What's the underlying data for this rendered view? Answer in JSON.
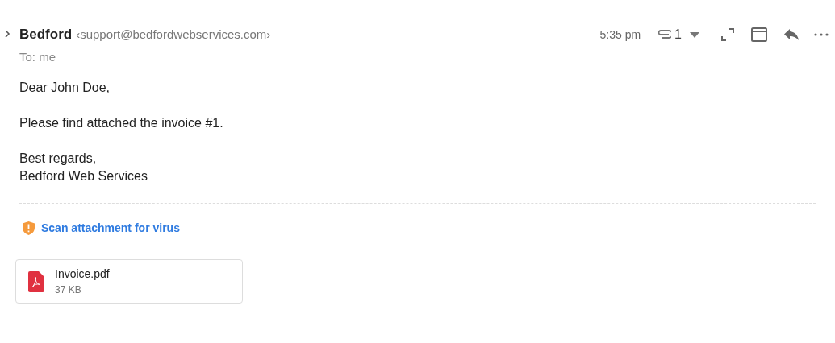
{
  "sender": {
    "name": "Bedford",
    "email": "‹support@bedfordwebservices.com›"
  },
  "to": "To: me",
  "time": "5:35 pm",
  "attachment_count": "1",
  "body": [
    [
      "Dear John Doe,"
    ],
    [
      "Please find attached the invoice #1."
    ],
    [
      "Best regards,",
      "Bedford Web Services"
    ]
  ],
  "scan_link": "Scan attachment for virus",
  "attachments": [
    {
      "name": "Invoice.pdf",
      "size": "37 KB"
    }
  ]
}
